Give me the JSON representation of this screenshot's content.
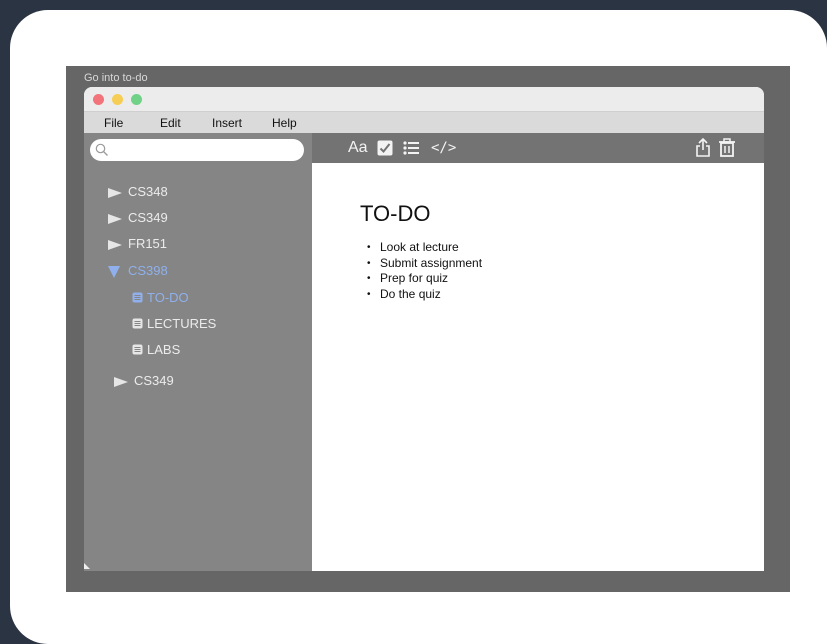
{
  "frame_title": "Go into to-do",
  "menu": {
    "file": "File",
    "edit": "Edit",
    "insert": "Insert",
    "help": "Help"
  },
  "search": {
    "placeholder": ""
  },
  "tree": {
    "cs348": "CS348",
    "cs349": "CS349",
    "fr151": "FR151",
    "cs398": "CS398",
    "cs398_children": {
      "todo": "TO-DO",
      "lectures": "LECTURES",
      "labs": "LABS"
    },
    "cs349_second": "CS349"
  },
  "toolbar": {
    "format_label": "Aa",
    "code_label": "</>"
  },
  "note": {
    "title": "TO-DO",
    "items": [
      "Look at lecture",
      "Submit assignment",
      "Prep for quiz",
      "Do the quiz"
    ]
  },
  "colors": {
    "background": "#2b3442",
    "frame": "#666666",
    "sidebar": "#858585",
    "toolbar": "#737373",
    "active": "#8fb0ec",
    "traffic_red": "#f2747a",
    "traffic_yellow": "#f6ce55",
    "traffic_green": "#6fd287"
  },
  "icons": {
    "search": "search-icon",
    "expand": "triangle-right-icon",
    "collapse": "triangle-down-icon",
    "doc": "document-icon",
    "check": "checkbox-icon",
    "list": "list-icon",
    "share": "share-icon",
    "trash": "trash-icon",
    "add": "plus-icon"
  }
}
